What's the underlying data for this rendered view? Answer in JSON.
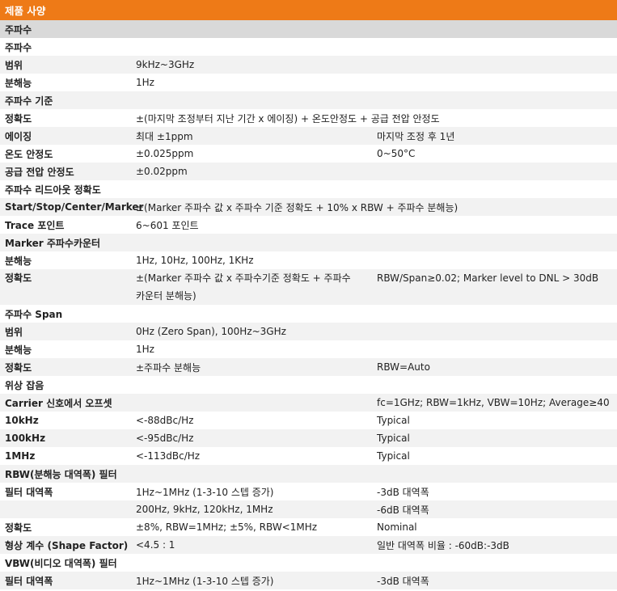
{
  "title": "제품 사양",
  "rows": [
    {
      "c1": "주파수",
      "c2": "",
      "c3": "",
      "style": "section-dark"
    },
    {
      "c1": "주파수",
      "c2": "",
      "c3": "",
      "style": "even"
    },
    {
      "c1": "범위",
      "c2": "9kHz~3GHz",
      "c3": "",
      "style": "odd"
    },
    {
      "c1": "분해능",
      "c2": "1Hz",
      "c3": "",
      "style": "even"
    },
    {
      "c1": "주파수 기준",
      "c2": "",
      "c3": "",
      "style": "odd"
    },
    {
      "c1": "정확도",
      "c2": "±(마지막 조정부터 지난 기간 x 에이징) + 온도안정도 + 공급 전압 안정도",
      "c3": "",
      "style": "even"
    },
    {
      "c1": "에이징",
      "c2": "최대 ±1ppm",
      "c3": "마지막 조정 후 1년",
      "style": "odd"
    },
    {
      "c1": "온도 안정도",
      "c2": "±0.025ppm",
      "c3": "0~50°C",
      "style": "even"
    },
    {
      "c1": "공급 전압 안정도",
      "c2": "±0.02ppm",
      "c3": "",
      "style": "odd"
    },
    {
      "c1": "주파수 리드아웃 정확도",
      "c2": "",
      "c3": "",
      "style": "even"
    },
    {
      "c1": "Start/Stop/Center/Marker",
      "c2": "±(Marker 주파수 값 x 주파수 기준 정확도 + 10% x RBW + 주파수 분해능)",
      "c3": "",
      "style": "odd"
    },
    {
      "c1": "Trace 포인트",
      "c2": "6~601 포인트",
      "c3": "",
      "style": "even"
    },
    {
      "c1": "Marker 주파수카운터",
      "c2": "",
      "c3": "",
      "style": "odd"
    },
    {
      "c1": "분해능",
      "c2": "1Hz, 10Hz, 100Hz, 1KHz",
      "c3": "",
      "style": "even"
    },
    {
      "c1": "정확도",
      "c2": "±(Marker 주파수 값 x 주파수기준 정확도 + 주파수 카운터 분해능)",
      "c3": "RBW/Span≥0.02; Marker level to DNL > 30dB",
      "style": "odd",
      "tall": true
    },
    {
      "c1": "주파수 Span",
      "c2": "",
      "c3": "",
      "style": "even"
    },
    {
      "c1": "범위",
      "c2": "0Hz (Zero Span), 100Hz~3GHz",
      "c3": "",
      "style": "odd"
    },
    {
      "c1": "분해능",
      "c2": "1Hz",
      "c3": "",
      "style": "even"
    },
    {
      "c1": "정확도",
      "c2": "±주파수 분해능",
      "c3": "RBW=Auto",
      "style": "odd"
    },
    {
      "c1": "위상 잡음",
      "c2": "",
      "c3": "",
      "style": "even"
    },
    {
      "c1": "Carrier 신호에서 오프셋",
      "c2": "",
      "c3": "fc=1GHz; RBW=1kHz, VBW=10Hz; Average≥40",
      "style": "odd"
    },
    {
      "c1": "10kHz",
      "c2": "<-88dBc/Hz",
      "c3": "Typical",
      "style": "even"
    },
    {
      "c1": "100kHz",
      "c2": "<-95dBc/Hz",
      "c3": "Typical",
      "style": "odd"
    },
    {
      "c1": "1MHz",
      "c2": "<-113dBc/Hz",
      "c3": "Typical",
      "style": "even"
    },
    {
      "c1": "RBW(분해능 대역폭) 필터",
      "c2": "",
      "c3": "",
      "style": "odd"
    },
    {
      "c1": "필터 대역폭",
      "c2": "1Hz~1MHz (1-3-10 스텝 증가)",
      "c3": "-3dB 대역폭",
      "style": "even"
    },
    {
      "c1": "",
      "c2": "200Hz, 9kHz, 120kHz, 1MHz",
      "c3": "-6dB 대역폭",
      "style": "odd"
    },
    {
      "c1": "정확도",
      "c2": "±8%, RBW=1MHz; ±5%, RBW<1MHz",
      "c3": "Nominal",
      "style": "even"
    },
    {
      "c1": "형상 계수 (Shape Factor)",
      "c2": "<4.5 : 1",
      "c3": "일반 대역폭 비율 : -60dB:-3dB",
      "style": "odd"
    },
    {
      "c1": "VBW(비디오 대역폭) 필터",
      "c2": "",
      "c3": "",
      "style": "even"
    },
    {
      "c1": "필터 대역폭",
      "c2": "1Hz~1MHz (1-3-10 스텝 증가)",
      "c3": "-3dB 대역폭",
      "style": "odd"
    }
  ]
}
